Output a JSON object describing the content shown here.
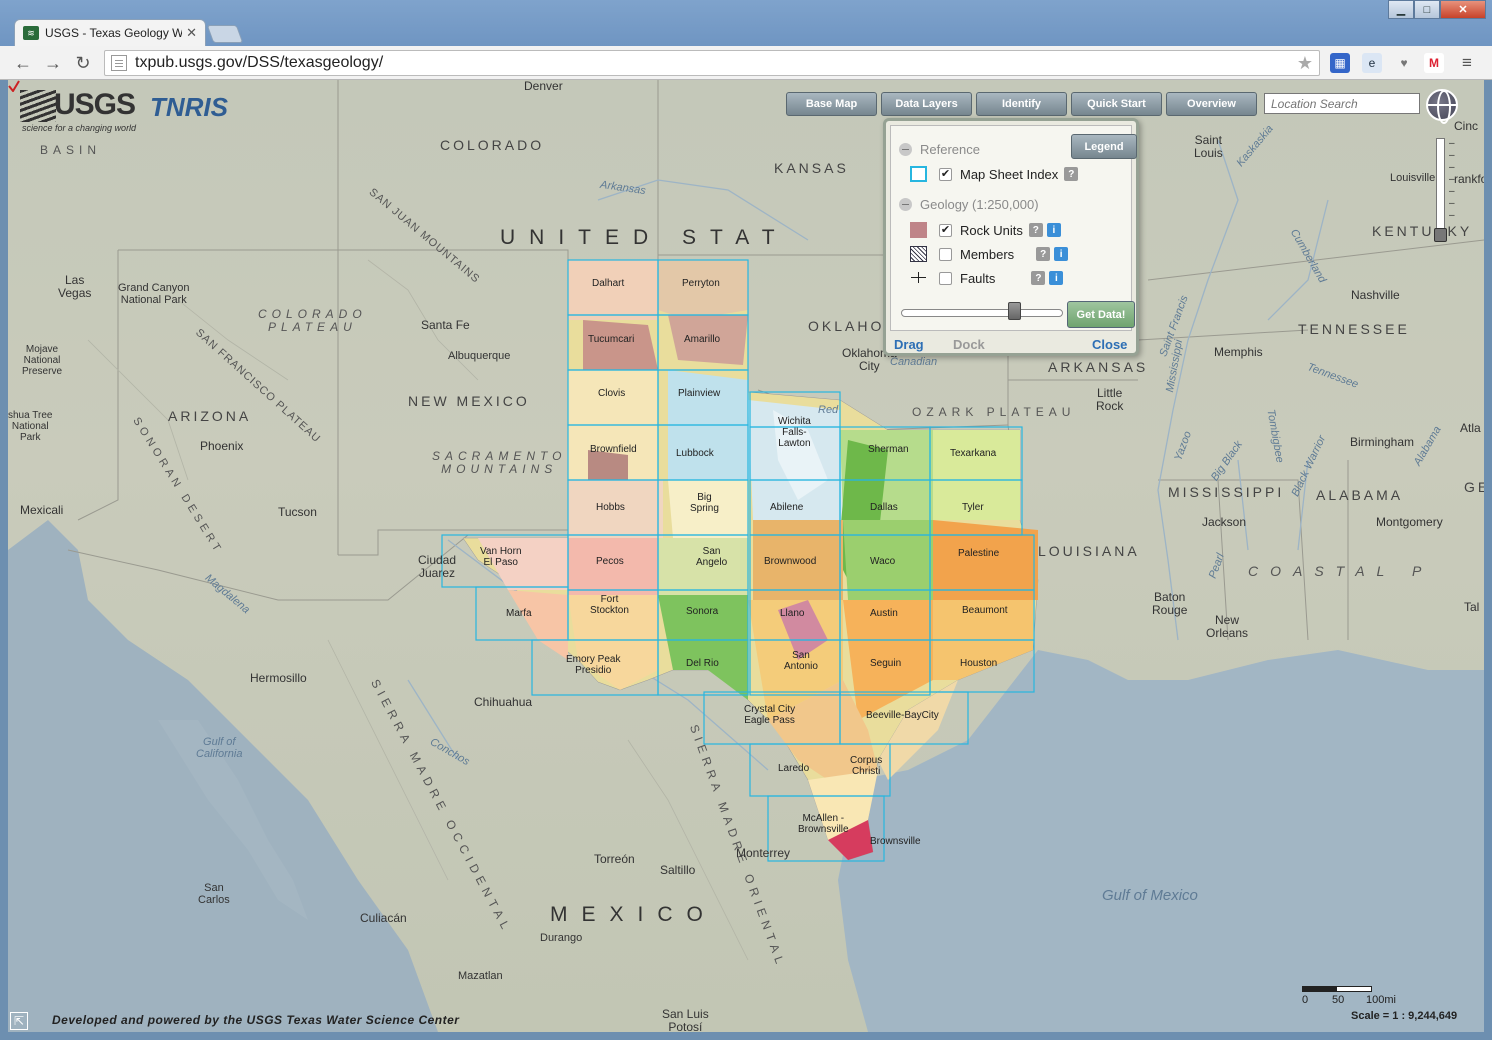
{
  "browser": {
    "tab_title": "USGS - Texas Geology We",
    "url": "txpub.usgs.gov/DSS/texasgeology/",
    "win_min": "▁",
    "win_max": "□",
    "win_close": "✕"
  },
  "logos": {
    "usgs": "USGS",
    "usgs_tagline": "science for a changing world",
    "tnris": "TNRIS"
  },
  "menu": {
    "base_map": "Base Map",
    "data_layers": "Data Layers",
    "identify": "Identify",
    "quick_start": "Quick Start",
    "overview": "Overview"
  },
  "search": {
    "placeholder": "Location Search"
  },
  "zoom_ticks": [
    "–",
    "–",
    "–",
    "–",
    "–",
    "–",
    "–"
  ],
  "panel": {
    "legend_button": "Legend",
    "reference_group": "Reference",
    "geology_group": "Geology (1:250,000)",
    "layers": [
      {
        "label": "Map Sheet Index",
        "checked": true
      },
      {
        "label": "Rock Units",
        "checked": true
      },
      {
        "label": "Members",
        "checked": false
      },
      {
        "label": "Faults",
        "checked": false
      }
    ],
    "check_glyph": "✔",
    "help_glyph": "?",
    "info_glyph": "i",
    "get_data": "Get Data!",
    "drag": "Drag",
    "dock": "Dock",
    "close": "Close",
    "opacity": 0.72
  },
  "scale": {
    "tick_0": "0",
    "tick_50": "50",
    "tick_100": "100mi",
    "text": "Scale = 1 : 9,244,649"
  },
  "credit": "Developed and powered by the USGS Texas Water Science Center",
  "map_labels": {
    "denver": "Denver",
    "colorado": "COLORADO",
    "kansas": "KANSAS",
    "arkansas_river": "Arkansas",
    "san_juan_mtns": "SAN JUAN MOUNTAINS",
    "united_states": "UNITED STAT",
    "basin": "BASIN",
    "las_vegas": "Las\nVegas",
    "grand_canyon": "Grand Canyon\nNational Park",
    "colorado_plateau": "COLORADO\nPLATEAU",
    "santa_fe": "Santa Fe",
    "albuquerque": "Albuquerque",
    "mojave": "Mojave\nNational\nPreserve",
    "san_francisco_plateau": "SAN FRANCISCO PLATEAU",
    "arizona": "ARIZONA",
    "new_mexico": "NEW MEXICO",
    "joshua_tree": "shua Tree\nNational\nPark",
    "phoenix": "Phoenix",
    "sonoran_desert": "SONORAN DESERT",
    "sacramento_mtns": "SACRAMENTO\nMOUNTAINS",
    "mexicali": "Mexicali",
    "tucson": "Tucson",
    "ciudad_juarez": "Ciudad\nJuarez",
    "oklahoma": "OKLAHO",
    "oklahoma_city": "Oklahoma\nCity",
    "canadian": "Canadian",
    "red_river": "Red",
    "ozark": "OZARK PLATEAU",
    "saint_louis": "Saint\nLouis",
    "kaskaskia": "Kaskaskia",
    "louisville": "Louisville",
    "cinc": "Cinc",
    "frankfo": "rankfo",
    "kentucky": "KENTUCKY",
    "nashville": "Nashville",
    "tennessee": "TENNESSEE",
    "cumberland": "Cumberland",
    "arkansas_state": "ARKANSAS",
    "little_rock": "Little\nRock",
    "memphis": "Memphis",
    "saint_francis": "Saint Francis",
    "mississippi_river": "Mississippi",
    "tennessee_river": "Tennessee",
    "birmingham": "Birmingham",
    "atla": "Atla",
    "mississippi_state": "MISSISSIPPI",
    "alabama": "ALABAMA",
    "ge": "GE",
    "yazoo": "Yazoo",
    "big_black": "Big Black",
    "black_warrior": "Black Warrior",
    "tombigbee": "Tombigbee",
    "alabama_river": "Alabama",
    "jackson": "Jackson",
    "montgomery": "Montgomery",
    "louisiana": "LOUISIANA",
    "pearl": "Pearl",
    "coastal_plain": "COASTAL P",
    "baton_rouge": "Baton\nRouge",
    "new_orleans": "New\nOrleans",
    "tal": "Tal",
    "hermosillo": "Hermosillo",
    "chihuahua": "Chihuahua",
    "gulf_of_california": "Gulf of\nCalifornia",
    "magdalena": "Magdalena",
    "sierra_madre_occ": "SIERRA MADRE OCCIDENTAL",
    "sierra_madre_or": "SIERRA MADRE ORIENTAL",
    "conchos": "Conchos",
    "torreon": "Torreón",
    "saltillo": "Saltillo",
    "monterrey": "Monterrey",
    "mexico": "MEXICO",
    "san_carlos": "San\nCarlos",
    "culiacan": "Culiacán",
    "durango": "Durango",
    "mazatlan": "Mazatlan",
    "san_luis_potosi": "San Luis\nPotosí",
    "gulf_of_mexico": "Gulf of Mexico"
  },
  "tx_sheets": {
    "dalhart": "Dalhart",
    "perryton": "Perryton",
    "tucumcari": "Tucumcari",
    "amarillo": "Amarillo",
    "clovis": "Clovis",
    "plainview": "Plainview",
    "wichita_falls": "Wichita\nFalls-\nLawton",
    "brownfield": "Brownfield",
    "lubbock": "Lubbock",
    "sherman": "Sherman",
    "texarkana": "Texarkana",
    "hobbs": "Hobbs",
    "big_spring": "Big\nSpring",
    "abilene": "Abilene",
    "dallas": "Dallas",
    "tyler": "Tyler",
    "van_horn": "Van Horn\nEl Paso",
    "pecos": "Pecos",
    "san_angelo": "San\nAngelo",
    "brownwood": "Brownwood",
    "waco": "Waco",
    "palestine": "Palestine",
    "marfa": "Marfa",
    "fort_stockton": "Fort\nStockton",
    "sonora": "Sonora",
    "llano": "Llano",
    "austin": "Austin",
    "beaumont": "Beaumont",
    "emory_peak": "Emory Peak\nPresidio",
    "del_rio": "Del Rio",
    "san_antonio": "San\nAntonio",
    "seguin": "Seguin",
    "houston": "Houston",
    "crystal_city": "Crystal City\nEagle Pass",
    "beeville": "Beeville-BayCity",
    "laredo": "Laredo",
    "corpus_christi": "Corpus\nChristi",
    "mcallen": "McAllen -\nBrownsville",
    "brownsville": "Brownsville"
  }
}
